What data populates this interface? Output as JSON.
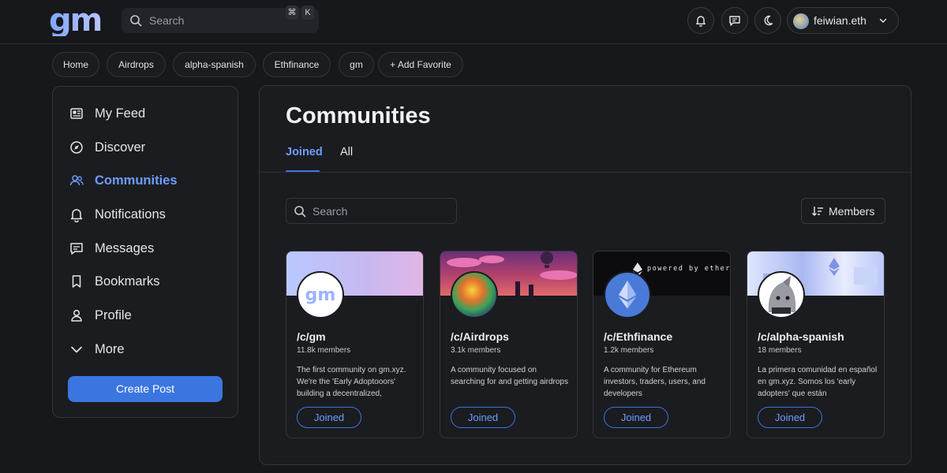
{
  "header": {
    "logo_text": "gm",
    "search_placeholder": "Search",
    "shortcut_keys": [
      "⌘",
      "K"
    ],
    "icons": [
      "bell-icon",
      "message-icon",
      "moon-icon"
    ],
    "user": {
      "name": "feiwian.eth"
    }
  },
  "favorites": {
    "items": [
      "Home",
      "Airdrops",
      "alpha-spanish",
      "Ethfinance",
      "gm"
    ],
    "add_label": "+ Add Favorite"
  },
  "sidebar": {
    "items": [
      {
        "label": "My Feed",
        "icon": "feed-icon"
      },
      {
        "label": "Discover",
        "icon": "compass-icon"
      },
      {
        "label": "Communities",
        "icon": "users-icon",
        "active": true
      },
      {
        "label": "Notifications",
        "icon": "bell-icon"
      },
      {
        "label": "Messages",
        "icon": "message-icon"
      },
      {
        "label": "Bookmarks",
        "icon": "bookmark-icon"
      },
      {
        "label": "Profile",
        "icon": "user-icon"
      },
      {
        "label": "More",
        "icon": "chevron-down-icon"
      }
    ],
    "create_post_label": "Create Post"
  },
  "main": {
    "title": "Communities",
    "tabs": [
      {
        "label": "Joined",
        "active": true
      },
      {
        "label": "All"
      }
    ],
    "search_placeholder": "Search",
    "sort_label": "Members",
    "communities": [
      {
        "name": "/c/gm",
        "members": "11.8k members",
        "description": "The first community on gm.xyz. We're the 'Early Adoptooors' building a decentralized,",
        "button_label": "Joined"
      },
      {
        "name": "/c/Airdrops",
        "members": "3.1k members",
        "description": "A community focused on searching for and getting airdrops",
        "button_label": "Joined"
      },
      {
        "name": "/c/Ethfinance",
        "members": "1.2k members",
        "description": "A community for Ethereum investors, traders, users, and developers",
        "banner_text": "powered by ethereum",
        "button_label": "Joined"
      },
      {
        "name": "/c/alpha-spanish",
        "members": "18 members",
        "description": "La primera comunidad en español en gm.xyz. Somos los 'early adopters' que están",
        "button_label": "Joined"
      }
    ]
  },
  "colors": {
    "background": "#17181c",
    "panel": "#1b1c20",
    "accent": "#3b76e0",
    "accent_text": "#6d9dff"
  }
}
